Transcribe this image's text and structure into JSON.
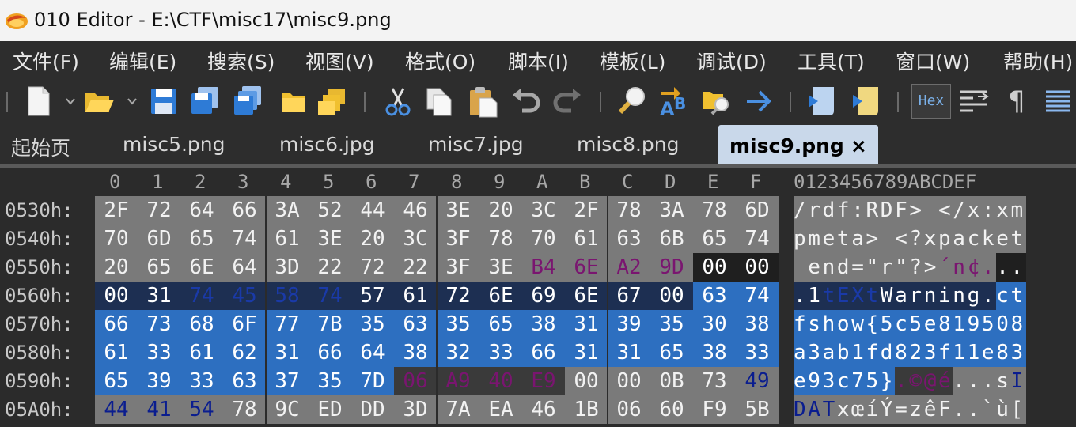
{
  "title_bar": {
    "text": "010 Editor - E:\\CTF\\misc17\\misc9.png"
  },
  "menu": [
    "文件(F)",
    "编辑(E)",
    "搜索(S)",
    "视图(V)",
    "格式(O)",
    "脚本(I)",
    "模板(L)",
    "调试(D)",
    "工具(T)",
    "窗口(W)",
    "帮助(H)"
  ],
  "toolbar": {
    "hex_label": "Hex",
    "pilcrow": "¶",
    "icons": [
      "new-file-icon",
      "open-folder-icon",
      "save-icon",
      "save-as-icon",
      "save-all-icon",
      "folder-icon",
      "open-workspace-icon",
      "cut-icon",
      "copy-icon",
      "paste-icon",
      "undo-icon",
      "redo-icon",
      "find-icon",
      "replace-icon",
      "find-in-files-icon",
      "goto-icon",
      "run-script-icon",
      "run-template-icon",
      "hex-toggle-icon",
      "compare-icon",
      "show-whitespace-icon",
      "columns-icon"
    ]
  },
  "tabs": [
    {
      "label": "起始页",
      "active": false
    },
    {
      "label": "misc5.png",
      "active": false
    },
    {
      "label": "misc6.jpg",
      "active": false
    },
    {
      "label": "misc7.jpg",
      "active": false
    },
    {
      "label": "misc8.png",
      "active": false
    },
    {
      "label": "misc9.png",
      "active": true,
      "close": "×"
    }
  ],
  "hex": {
    "columns": [
      "0",
      "1",
      "2",
      "3",
      "4",
      "5",
      "6",
      "7",
      "8",
      "9",
      "A",
      "B",
      "C",
      "D",
      "E",
      "F"
    ],
    "ascii_header": "0123456789ABCDEF",
    "rows": [
      {
        "offset": "0530h:",
        "bytes": [
          "2F",
          "72",
          "64",
          "66",
          "3A",
          "52",
          "44",
          "46",
          "3E",
          "20",
          "3C",
          "2F",
          "78",
          "3A",
          "78",
          "6D"
        ],
        "ascii": "/rdf:RDF> </x:xm"
      },
      {
        "offset": "0540h:",
        "bytes": [
          "70",
          "6D",
          "65",
          "74",
          "61",
          "3E",
          "20",
          "3C",
          "3F",
          "78",
          "70",
          "61",
          "63",
          "6B",
          "65",
          "74"
        ],
        "ascii": "pmeta> <?xpacket"
      },
      {
        "offset": "0550h:",
        "bytes": [
          "20",
          "65",
          "6E",
          "64",
          "3D",
          "22",
          "72",
          "22",
          "3F",
          "3E",
          "B4",
          "6E",
          "A2",
          "9D",
          "00",
          "00"
        ],
        "ascii": " end=\"r\"?>´n¢..."
      },
      {
        "offset": "0560h:",
        "bytes": [
          "00",
          "31",
          "74",
          "45",
          "58",
          "74",
          "57",
          "61",
          "72",
          "6E",
          "69",
          "6E",
          "67",
          "00",
          "63",
          "74"
        ],
        "ascii": ".1tEXtWarning.ct"
      },
      {
        "offset": "0570h:",
        "bytes": [
          "66",
          "73",
          "68",
          "6F",
          "77",
          "7B",
          "35",
          "63",
          "35",
          "65",
          "38",
          "31",
          "39",
          "35",
          "30",
          "38"
        ],
        "ascii": "fshow{5c5e819508"
      },
      {
        "offset": "0580h:",
        "bytes": [
          "61",
          "33",
          "61",
          "62",
          "31",
          "66",
          "64",
          "38",
          "32",
          "33",
          "66",
          "31",
          "31",
          "65",
          "38",
          "33"
        ],
        "ascii": "a3ab1fd823f11e83"
      },
      {
        "offset": "0590h:",
        "bytes": [
          "65",
          "39",
          "33",
          "63",
          "37",
          "35",
          "7D",
          "06",
          "A9",
          "40",
          "E9",
          "00",
          "00",
          "0B",
          "73",
          "49"
        ],
        "ascii": "e93c75}.©@é...sI"
      },
      {
        "offset": "05A0h:",
        "bytes": [
          "44",
          "41",
          "54",
          "78",
          "9C",
          "ED",
          "DD",
          "3D",
          "7A",
          "EA",
          "46",
          "1B",
          "06",
          "60",
          "F9",
          "5B"
        ],
        "ascii": "DATxœíÝ=zêF..`ù["
      }
    ]
  },
  "colors": {
    "background": "#2b2b2b",
    "hex_gray": "#7a7a7a",
    "selection": "#2d6fc0",
    "chunk_type": "#1d2f52",
    "crc": "#3a3a3a",
    "zero_pad": "#1f1f1f",
    "purple_text": "#7a1570",
    "navy_text": "#0a1d8f"
  }
}
